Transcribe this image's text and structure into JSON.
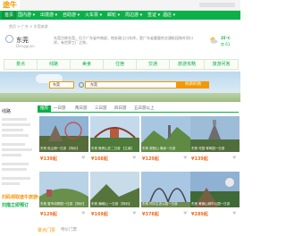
{
  "header": {
    "logo_text": "途牛"
  },
  "nav": {
    "items": [
      {
        "label": "首页"
      },
      {
        "label": "国内游 ▾"
      },
      {
        "label": "出境游 ▾"
      },
      {
        "label": "自助游 ▾"
      },
      {
        "label": "火车票 ▾"
      },
      {
        "label": "邮轮 ▾"
      },
      {
        "label": "周边游 ▾"
      },
      {
        "label": "签证 ▾"
      },
      {
        "label": "酒店 ▾"
      }
    ]
  },
  "breadcrumb": "首页 > 广东 > 东莞旅游",
  "city": {
    "name": "东莞",
    "en": "Dongguan",
    "intro": "东莞古称东莞，位于广东省中南部，地处珠江口东岸，是广东省重要的交通枢纽和外贸口岸，有世界工厂之称。",
    "temp": "25℃",
    "aqi": "良 61"
  },
  "categories": [
    "景点",
    "线路",
    "美食",
    "住宿",
    "交通",
    "旅游攻略",
    "旅游问答"
  ],
  "search": {
    "city_value": "东莞",
    "query_value": "东莞",
    "button_label": "找目的地"
  },
  "sidebar": {
    "title": "线路",
    "promo_line1": "扫码领取途牛旅游小程序",
    "promo_line2": "扫描立即预订"
  },
  "filters": [
    "推荐",
    "一日游",
    "两日游",
    "三日游",
    "四日游",
    "五日游以上"
  ],
  "cards": [
    {
      "caption": "东莞 松山湖一日游 【特价】",
      "price": "¥139起"
    },
    {
      "caption": "东莞 隐贤山庄二日游 【立减】",
      "price": "¥168起"
    },
    {
      "caption": "东莞 观音山 清溪一日游",
      "price": "¥129起"
    },
    {
      "caption": "东莞 可园 粤晖园一日游",
      "price": "¥139起"
    },
    {
      "caption": "东莞 香市动物园一日游 【特价】",
      "price": "¥129起"
    },
    {
      "caption": "东莞 巍峨山 一日游 【特价】",
      "price": "¥169起"
    },
    {
      "caption": "东莞 同沙生态公园一日游",
      "price": "¥378起"
    },
    {
      "caption": "东莞 黄旗山城市公园一日游",
      "price": "¥289起"
    }
  ],
  "bottom": {
    "title": "景点门票",
    "tab": "特价门票"
  },
  "colors": {
    "brand_green": "#0bb04a",
    "accent_orange": "#f39800"
  }
}
